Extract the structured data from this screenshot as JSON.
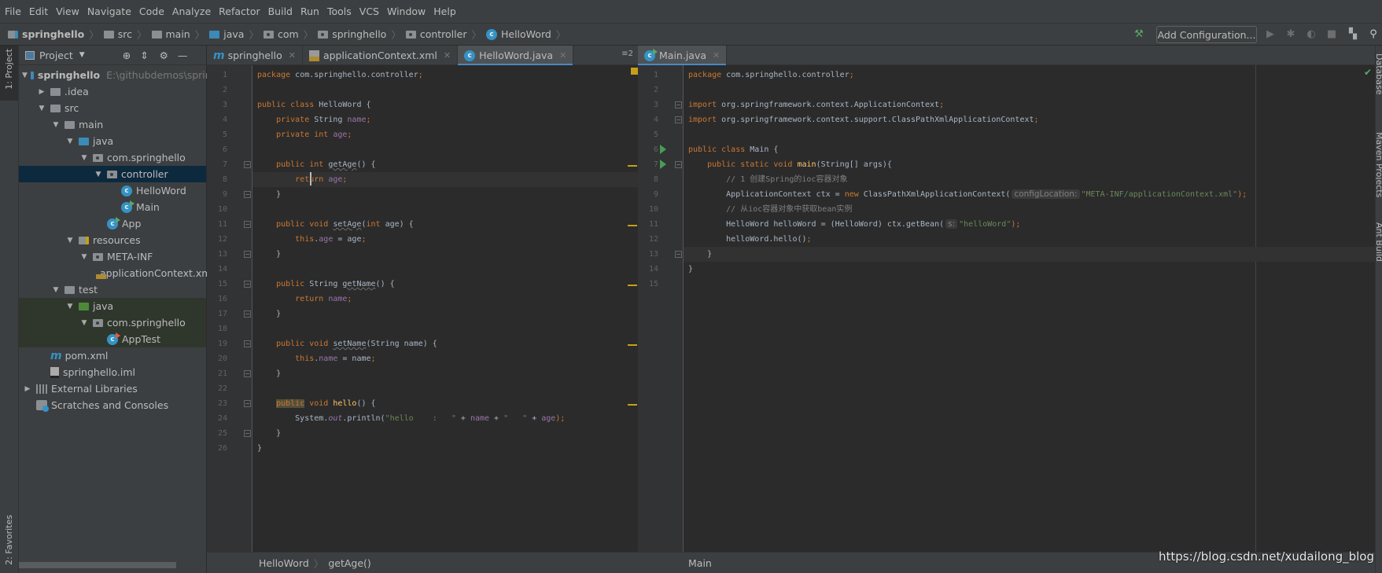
{
  "menu": [
    "File",
    "Edit",
    "View",
    "Navigate",
    "Code",
    "Analyze",
    "Refactor",
    "Build",
    "Run",
    "Tools",
    "VCS",
    "Window",
    "Help"
  ],
  "breadcrumb": [
    {
      "label": "springhello",
      "icon": "module-folder-icon"
    },
    {
      "label": "src",
      "icon": "folder-icon"
    },
    {
      "label": "main",
      "icon": "folder-icon"
    },
    {
      "label": "java",
      "icon": "source-folder-icon"
    },
    {
      "label": "com",
      "icon": "package-icon"
    },
    {
      "label": "springhello",
      "icon": "package-icon"
    },
    {
      "label": "controller",
      "icon": "package-icon"
    },
    {
      "label": "HelloWord",
      "icon": "class-icon"
    }
  ],
  "toolbar": {
    "add_configuration": "Add Configuration..."
  },
  "left_stripe": {
    "project": "1: Project",
    "favorites": "2: Favorites"
  },
  "right_stripe": {
    "database": "Database",
    "maven": "Maven Projects",
    "ant": "Ant Build"
  },
  "project_panel": {
    "title": "Project",
    "tree": [
      {
        "label": "springhello",
        "hint": "E:\\githubdemos\\spring",
        "level": 0,
        "arrow": "open",
        "icon": "module",
        "bold": true
      },
      {
        "label": ".idea",
        "level": 1,
        "arrow": "closed",
        "icon": "folder"
      },
      {
        "label": "src",
        "level": 1,
        "arrow": "open",
        "icon": "folder"
      },
      {
        "label": "main",
        "level": 2,
        "arrow": "open",
        "icon": "folder"
      },
      {
        "label": "java",
        "level": 3,
        "arrow": "open",
        "icon": "source"
      },
      {
        "label": "com.springhello",
        "level": 4,
        "arrow": "open",
        "icon": "package"
      },
      {
        "label": "controller",
        "level": 5,
        "arrow": "open",
        "icon": "package",
        "selected": true
      },
      {
        "label": "HelloWord",
        "level": 6,
        "icon": "class"
      },
      {
        "label": "Main",
        "level": 6,
        "icon": "class-run"
      },
      {
        "label": "App",
        "level": 5,
        "icon": "class-run"
      },
      {
        "label": "resources",
        "level": 3,
        "arrow": "open",
        "icon": "resources"
      },
      {
        "label": "META-INF",
        "level": 4,
        "arrow": "open",
        "icon": "package"
      },
      {
        "label": "applicationContext.xml",
        "level": 5,
        "icon": "xml"
      },
      {
        "label": "test",
        "level": 2,
        "arrow": "open",
        "icon": "folder"
      },
      {
        "label": "java",
        "level": 3,
        "arrow": "open",
        "icon": "test-source",
        "test": true
      },
      {
        "label": "com.springhello",
        "level": 4,
        "arrow": "open",
        "icon": "package",
        "test": true
      },
      {
        "label": "AppTest",
        "level": 5,
        "icon": "class-test",
        "test": true
      },
      {
        "label": "pom.xml",
        "level": 1,
        "icon": "maven"
      },
      {
        "label": "springhello.iml",
        "level": 1,
        "icon": "iml"
      },
      {
        "label": "External Libraries",
        "level": 0,
        "arrow": "closed",
        "icon": "libraries"
      },
      {
        "label": "Scratches and Consoles",
        "level": 0,
        "icon": "scratches"
      }
    ]
  },
  "editor_left": {
    "tabs": [
      {
        "label": "springhello",
        "icon": "maven"
      },
      {
        "label": "applicationContext.xml",
        "icon": "xml"
      },
      {
        "label": "HelloWord.java",
        "icon": "class",
        "active": true
      }
    ],
    "tab_count": "≡2",
    "breadcrumb": [
      "HelloWord",
      "getAge()"
    ],
    "current_line": 8,
    "folds": [
      7,
      9,
      11,
      13,
      15,
      17,
      19,
      21,
      23,
      25
    ],
    "warning_lines": [
      7,
      11,
      15,
      19,
      23
    ],
    "lines": [
      [
        [
          "package",
          "keyword"
        ],
        [
          " com.springhello.controller",
          "plain"
        ],
        [
          ";",
          "keyword"
        ]
      ],
      [],
      [
        [
          "public class ",
          "keyword"
        ],
        [
          "HelloWord {",
          "plain"
        ]
      ],
      [
        [
          "    private ",
          "keyword"
        ],
        [
          "String ",
          "plain"
        ],
        [
          "name",
          "field"
        ],
        [
          ";",
          "keyword"
        ]
      ],
      [
        [
          "    private int ",
          "keyword"
        ],
        [
          "age",
          "field"
        ],
        [
          ";",
          "keyword"
        ]
      ],
      [],
      [
        [
          "    public int ",
          "keyword"
        ],
        [
          "getAge",
          "unused"
        ],
        [
          "() {",
          "plain"
        ]
      ],
      [
        [
          "        return ",
          "keyword"
        ],
        [
          "age",
          "field"
        ],
        [
          ";",
          "keyword"
        ]
      ],
      [
        [
          "    }",
          "plain"
        ]
      ],
      [],
      [
        [
          "    public void ",
          "keyword"
        ],
        [
          "setAge",
          "unused"
        ],
        [
          "(",
          "plain"
        ],
        [
          "int ",
          "keyword"
        ],
        [
          "age) {",
          "plain"
        ]
      ],
      [
        [
          "        this",
          "keyword"
        ],
        [
          ".",
          "plain"
        ],
        [
          "age",
          "field"
        ],
        [
          " = age",
          "plain"
        ],
        [
          ";",
          "keyword"
        ]
      ],
      [
        [
          "    }",
          "plain"
        ]
      ],
      [],
      [
        [
          "    public ",
          "keyword"
        ],
        [
          "String ",
          "plain"
        ],
        [
          "getName",
          "unused"
        ],
        [
          "() {",
          "plain"
        ]
      ],
      [
        [
          "        return ",
          "keyword"
        ],
        [
          "name",
          "field"
        ],
        [
          ";",
          "keyword"
        ]
      ],
      [
        [
          "    }",
          "plain"
        ]
      ],
      [],
      [
        [
          "    public void ",
          "keyword"
        ],
        [
          "setName",
          "unused"
        ],
        [
          "(String name) {",
          "plain"
        ]
      ],
      [
        [
          "        this",
          "keyword"
        ],
        [
          ".",
          "plain"
        ],
        [
          "name",
          "field"
        ],
        [
          " = name",
          "plain"
        ],
        [
          ";",
          "keyword"
        ]
      ],
      [
        [
          "    }",
          "plain"
        ]
      ],
      [],
      [
        [
          "    ",
          "plain"
        ],
        [
          "public",
          "hl"
        ],
        [
          " void ",
          "keyword"
        ],
        [
          "hello",
          "decl"
        ],
        [
          "() {",
          "plain"
        ]
      ],
      [
        [
          "        System.",
          "plain"
        ],
        [
          "out",
          "static"
        ],
        [
          ".println(",
          "plain"
        ],
        [
          "\"hello    :   \"",
          "string"
        ],
        [
          " + ",
          "plain"
        ],
        [
          "name",
          "field"
        ],
        [
          " + ",
          "plain"
        ],
        [
          "\"   \"",
          "string"
        ],
        [
          " + ",
          "plain"
        ],
        [
          "age",
          "field"
        ],
        [
          ");",
          "keyword"
        ]
      ],
      [
        [
          "    }",
          "plain"
        ]
      ],
      [
        [
          "}",
          "plain"
        ]
      ]
    ]
  },
  "editor_right": {
    "tabs": [
      {
        "label": "Main.java",
        "icon": "class-run",
        "active": true
      }
    ],
    "breadcrumb": [
      "Main"
    ],
    "current_line": 13,
    "folds": [
      3,
      4,
      7,
      13
    ],
    "run_lines": [
      6,
      7
    ],
    "lines": [
      [
        [
          "package",
          "keyword"
        ],
        [
          " com.springhello.controller",
          "plain"
        ],
        [
          ";",
          "keyword"
        ]
      ],
      [],
      [
        [
          "import",
          "keyword"
        ],
        [
          " org.springframework.context.ApplicationContext",
          "plain"
        ],
        [
          ";",
          "keyword"
        ]
      ],
      [
        [
          "import",
          "keyword"
        ],
        [
          " org.springframework.context.support.ClassPathXmlApplicationContext",
          "plain"
        ],
        [
          ";",
          "keyword"
        ]
      ],
      [],
      [
        [
          "public class ",
          "keyword"
        ],
        [
          "Main {",
          "plain"
        ]
      ],
      [
        [
          "    public static void ",
          "keyword"
        ],
        [
          "main",
          "decl"
        ],
        [
          "(String[] args){",
          "plain"
        ]
      ],
      [
        [
          "        // 1 创建Spring的ioc容器对象",
          "comment"
        ]
      ],
      [
        [
          "        ApplicationContext ctx = ",
          "plain"
        ],
        [
          "new ",
          "keyword"
        ],
        [
          "ClassPathXmlApplicationContext(",
          "plain"
        ],
        [
          "configLocation:",
          "hint"
        ],
        [
          "\"META-INF/applicationContext.xml\"",
          "string"
        ],
        [
          ");",
          "keyword"
        ]
      ],
      [
        [
          "        // 从ioc容器对象中获取bean实例",
          "comment"
        ]
      ],
      [
        [
          "        HelloWord helloWord = (HelloWord) ctx.getBean(",
          "plain"
        ],
        [
          "s:",
          "hint"
        ],
        [
          "\"helloWord\"",
          "string"
        ],
        [
          ");",
          "keyword"
        ]
      ],
      [
        [
          "        helloWord.hello()",
          "plain"
        ],
        [
          ";",
          "keyword"
        ]
      ],
      [
        [
          "    }",
          "plain"
        ]
      ],
      [
        [
          "}",
          "plain"
        ]
      ],
      []
    ]
  },
  "watermark": "https://blog.csdn.net/xudailong_blog"
}
